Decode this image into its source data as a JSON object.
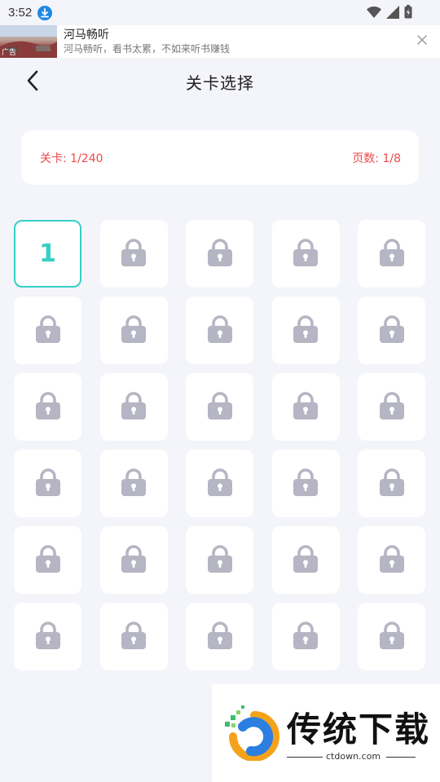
{
  "status_bar": {
    "time": "3:52"
  },
  "ad": {
    "thumb_tag": "广告",
    "title": "河马畅听",
    "subtitle": "河马畅听，看书太累，不如来听书赚钱"
  },
  "header": {
    "title": "关卡选择"
  },
  "info": {
    "level_label": "关卡: 1/240",
    "page_label": "页数: 1/8"
  },
  "levels": [
    {
      "number": "1",
      "locked": false
    },
    {
      "locked": true
    },
    {
      "locked": true
    },
    {
      "locked": true
    },
    {
      "locked": true
    },
    {
      "locked": true
    },
    {
      "locked": true
    },
    {
      "locked": true
    },
    {
      "locked": true
    },
    {
      "locked": true
    },
    {
      "locked": true
    },
    {
      "locked": true
    },
    {
      "locked": true
    },
    {
      "locked": true
    },
    {
      "locked": true
    },
    {
      "locked": true
    },
    {
      "locked": true
    },
    {
      "locked": true
    },
    {
      "locked": true
    },
    {
      "locked": true
    },
    {
      "locked": true
    },
    {
      "locked": true
    },
    {
      "locked": true
    },
    {
      "locked": true
    },
    {
      "locked": true
    },
    {
      "locked": true
    },
    {
      "locked": true
    },
    {
      "locked": true
    },
    {
      "locked": true
    },
    {
      "locked": true
    }
  ],
  "watermark": {
    "name": "传统下载",
    "url": "ctdown.com"
  },
  "colors": {
    "accent": "#36cfc5",
    "info_text": "#f04a4a",
    "lock": "#b5b5c3",
    "background": "#f4f4fb"
  }
}
